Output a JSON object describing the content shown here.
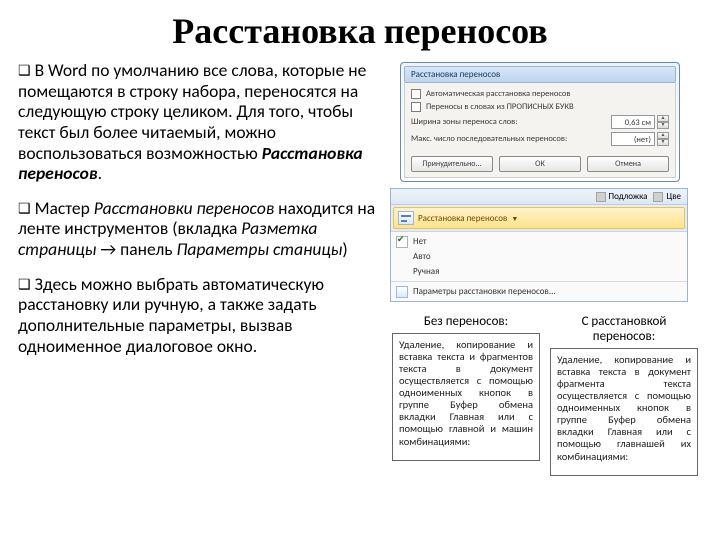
{
  "title": "Расстановка переносов",
  "paragraphs": {
    "p1a": "В Word по умолчанию все слова, которые не помещаются в строку набора, переносятся на следующую строку целиком.  Для того, чтобы текст был более читаемый, можно воспользоваться возможностью ",
    "p1b": "Расстановка переносов",
    "p2a": "Мастер ",
    "p2b": "Расстановки переносов",
    "p2c": " находится на ленте инструментов (вкладка ",
    "p2d": "Разметка страницы",
    "p2e": " → панель ",
    "p2f": "Параметры станицы",
    "p2g": ")",
    "p3": "Здесь можно выбрать автоматическую расстановку или ручную, а также задать дополнительные параметры, вызвав одноименное диалоговое окно."
  },
  "dialog": {
    "title": "Расстановка переносов",
    "chk1": "Автоматическая расстановка переносов",
    "chk2": "Переносы в словах из ПРОПИСНЫХ БУКВ",
    "row1_label": "Ширина зоны переноса слов:",
    "row1_value": "0,63 см",
    "row2_label": "Макс. число последовательных переносов:",
    "row2_value": "(нет)",
    "btn1": "Принудительно...",
    "btn2": "ОК",
    "btn3": "Отмена"
  },
  "ribbon": {
    "top1": "Подложка",
    "top2": "Цве",
    "hyph_label": "Расстановка переносов",
    "menu": {
      "m1": "Нет",
      "m2": "Авто",
      "m3": "Ручная",
      "m4": "Параметры расстановки переносов..."
    }
  },
  "compare": {
    "left_label": "Без переносов:",
    "right_label": "С расстановкой переносов:",
    "left_text": "Удаление, копирование и вставка текста и фрагментов текста в документ осуществляется с помощью одноименных кнопок в группе Буфер обмена вкладки Главная или с помощью главной и машин комбинациями:",
    "right_text": "Удаление, копирование и встав­ка текста в документ фрагмента текста осуществляется с помо­щью одноименных кнопок в группе Буфер обмена вкладки Главная или с помощью главна­шей их комбинациями:"
  }
}
